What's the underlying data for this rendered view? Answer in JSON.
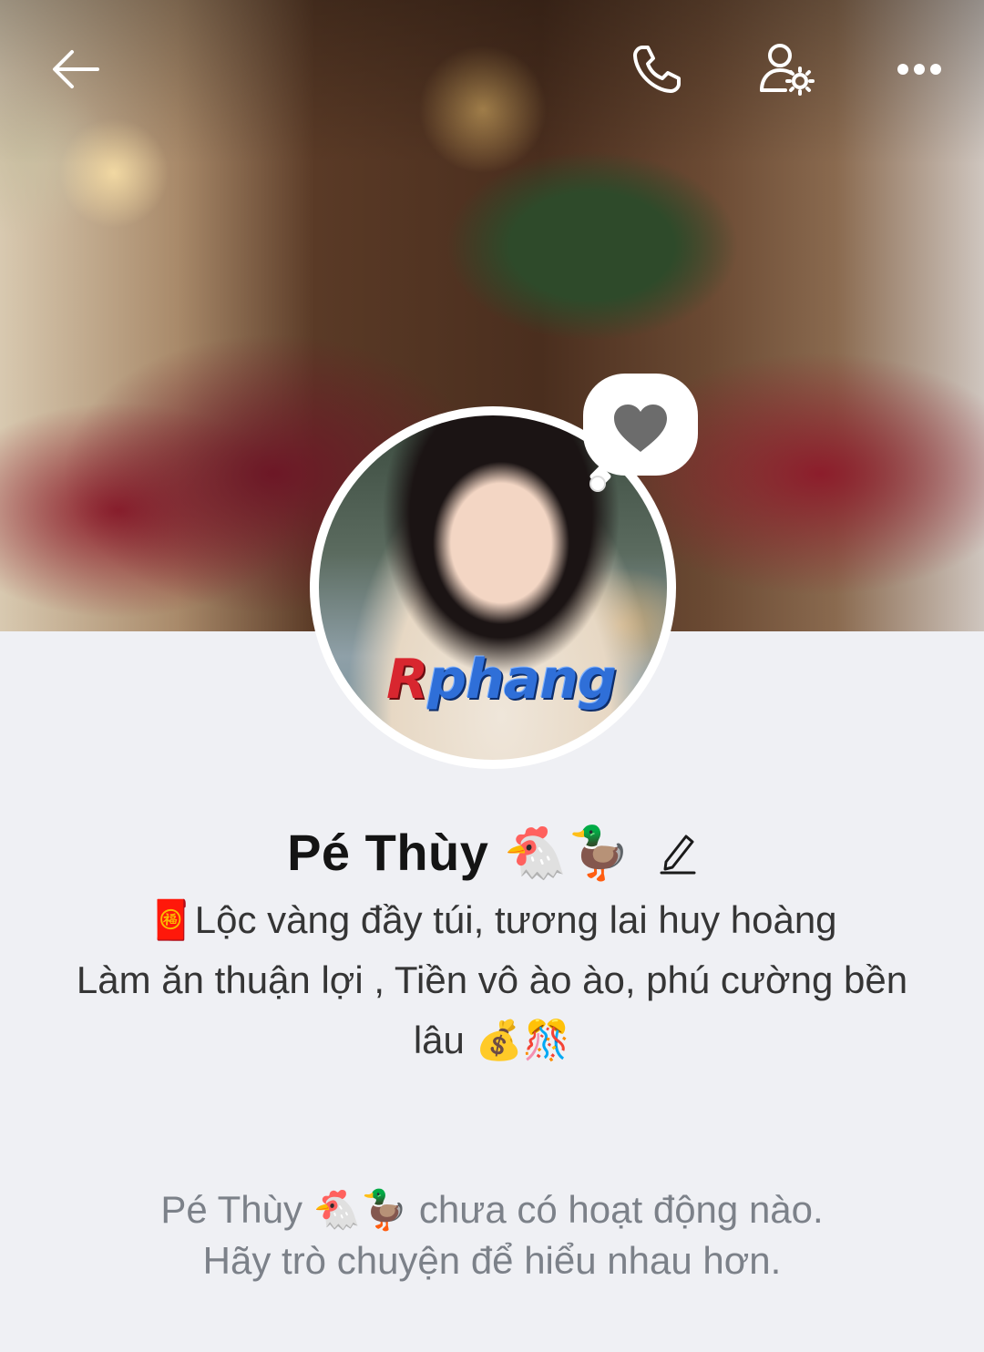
{
  "profile": {
    "name": "Pé Thùy 🐔🦆",
    "bio_line1": "🧧Lộc vàng đầy túi, tương lai huy hoàng",
    "bio_line2": "Làm ăn thuận lợi , Tiền vô ào ào,  phú cường bền",
    "bio_line3": "lâu 💰🎊",
    "avatar_watermark_r": "R",
    "avatar_watermark_rest": "phang"
  },
  "empty_state": {
    "line1": "Pé Thùy 🐔🦆 chưa có hoạt động nào.",
    "line2": "Hãy trò chuyện để hiểu nhau hơn."
  },
  "icons": {
    "back": "back-arrow-icon",
    "call": "phone-icon",
    "profile_settings": "user-settings-icon",
    "more": "more-icon",
    "heart": "heart-icon",
    "edit": "pencil-icon"
  },
  "colors": {
    "background": "#eff0f4",
    "name_text": "#141414",
    "bio_text": "#353535",
    "muted_text": "#7c8189",
    "heart": "#6c6c6c"
  }
}
